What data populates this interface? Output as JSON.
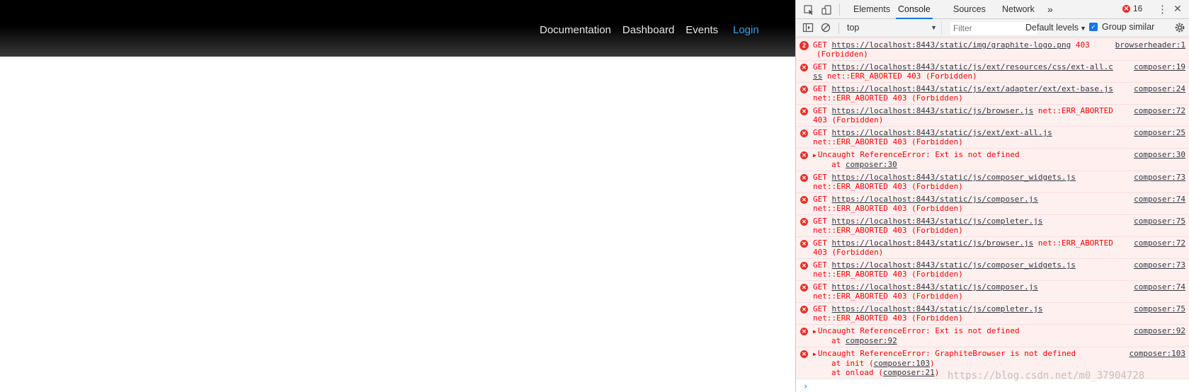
{
  "navbar": {
    "links": [
      "Documentation",
      "Dashboard",
      "Events"
    ],
    "login": "Login",
    "login_color": "#2ea3f2"
  },
  "devtools": {
    "tabs": [
      "Elements",
      "Console",
      "Sources",
      "Network"
    ],
    "active_tab": "Console",
    "more": "»",
    "error_count": "16",
    "close": "✕",
    "menu": "⋮",
    "context": "top",
    "filter_placeholder": "Filter",
    "levels": "Default levels",
    "group_similar": "Group similar"
  },
  "console": [
    {
      "count": "2",
      "method": "GET",
      "url": "https://localhost:8443/static/img/graphite-logo.png",
      "after": " 403",
      "line2": "(Forbidden)",
      "source": "browserheader:1"
    },
    {
      "method": "GET",
      "url": "https://localhost:8443/static/js/ext/resources/css/ext-all.c",
      "line2_url": "ss",
      "line2": " net::ERR_ABORTED 403 (Forbidden)",
      "source": "composer:19"
    },
    {
      "method": "GET",
      "url": "https://localhost:8443/static/js/ext/adapter/ext/ext-base.js",
      "line2": "net::ERR_ABORTED 403 (Forbidden)",
      "source": "composer:24"
    },
    {
      "method": "GET",
      "url": "https://localhost:8443/static/js/browser.js",
      "after": " net::ERR_ABORTED",
      "line2": "403 (Forbidden)",
      "source": "composer:72"
    },
    {
      "method": "GET",
      "url": "https://localhost:8443/static/js/ext/ext-all.js",
      "line2": "net::ERR_ABORTED 403 (Forbidden)",
      "source": "composer:25"
    },
    {
      "uncaught": "Uncaught ReferenceError: Ext is not defined",
      "stack": [
        {
          "pre": "at ",
          "link": "composer:30",
          "post": ""
        }
      ],
      "source": "composer:30"
    },
    {
      "method": "GET",
      "url": "https://localhost:8443/static/js/composer_widgets.js",
      "line2": "net::ERR_ABORTED 403 (Forbidden)",
      "source": "composer:73"
    },
    {
      "method": "GET",
      "url": "https://localhost:8443/static/js/composer.js",
      "line2": "net::ERR_ABORTED 403 (Forbidden)",
      "source": "composer:74"
    },
    {
      "method": "GET",
      "url": "https://localhost:8443/static/js/completer.js",
      "line2": "net::ERR_ABORTED 403 (Forbidden)",
      "source": "composer:75"
    },
    {
      "method": "GET",
      "url": "https://localhost:8443/static/js/browser.js",
      "after": " net::ERR_ABORTED",
      "line2": "403 (Forbidden)",
      "source": "composer:72"
    },
    {
      "method": "GET",
      "url": "https://localhost:8443/static/js/composer_widgets.js",
      "line2": "net::ERR_ABORTED 403 (Forbidden)",
      "source": "composer:73"
    },
    {
      "method": "GET",
      "url": "https://localhost:8443/static/js/composer.js",
      "line2": "net::ERR_ABORTED 403 (Forbidden)",
      "source": "composer:74"
    },
    {
      "method": "GET",
      "url": "https://localhost:8443/static/js/completer.js",
      "line2": "net::ERR_ABORTED 403 (Forbidden)",
      "source": "composer:75"
    },
    {
      "uncaught": "Uncaught ReferenceError: Ext is not defined",
      "stack": [
        {
          "pre": "at ",
          "link": "composer:92",
          "post": ""
        }
      ],
      "source": "composer:92"
    },
    {
      "uncaught": "Uncaught ReferenceError: GraphiteBrowser is not defined",
      "stack": [
        {
          "pre": "at init (",
          "link": "composer:103",
          "post": ")"
        },
        {
          "pre": "at onload (",
          "link": "composer:21",
          "post": ")"
        }
      ],
      "source": "composer:103"
    }
  ],
  "prompt": "›",
  "watermark": "https://blog.csdn.net/m0_37904728"
}
